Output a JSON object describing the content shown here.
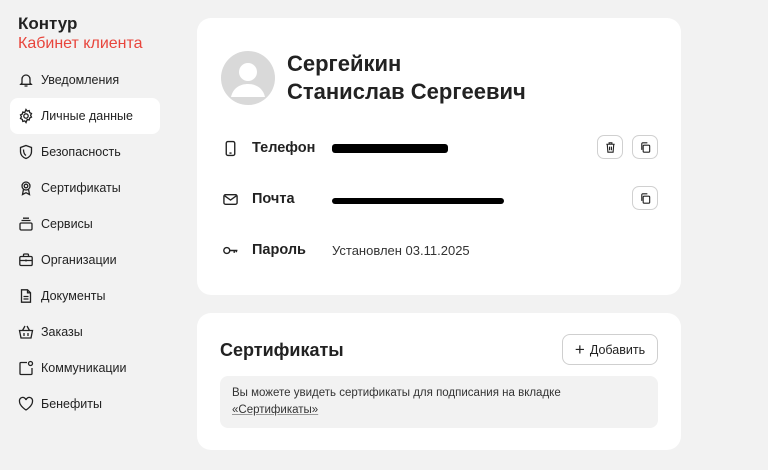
{
  "brand": {
    "title": "Контур",
    "subtitle": "Кабинет клиента"
  },
  "sidebar": {
    "items": [
      {
        "label": "Уведомления",
        "icon": "bell-icon"
      },
      {
        "label": "Личные данные",
        "icon": "gear-icon",
        "active": true
      },
      {
        "label": "Безопасность",
        "icon": "shield-icon"
      },
      {
        "label": "Сертификаты",
        "icon": "certificate-icon"
      },
      {
        "label": "Сервисы",
        "icon": "services-icon"
      },
      {
        "label": "Организации",
        "icon": "briefcase-icon"
      },
      {
        "label": "Документы",
        "icon": "document-icon"
      },
      {
        "label": "Заказы",
        "icon": "basket-icon"
      },
      {
        "label": "Коммуникации",
        "icon": "chat-icon"
      },
      {
        "label": "Бенефиты",
        "icon": "heart-icon"
      }
    ]
  },
  "profile": {
    "name_line1": "Сергейкин",
    "name_line2": "Станислав Сергеевич",
    "phone": {
      "label": "Телефон",
      "value": "[redacted]"
    },
    "email": {
      "label": "Почта",
      "value": "[redacted]"
    },
    "password": {
      "label": "Пароль",
      "value": "Установлен 03.11.2025"
    }
  },
  "certificates": {
    "title": "Сертификаты",
    "add_label": "Добавить",
    "info_text": "Вы можете увидеть сертификаты для подписания на вкладке",
    "info_link": "«Сертификаты»"
  },
  "colors": {
    "brand_accent": "#e8453c",
    "background": "#f2f2f2",
    "card": "#ffffff"
  }
}
